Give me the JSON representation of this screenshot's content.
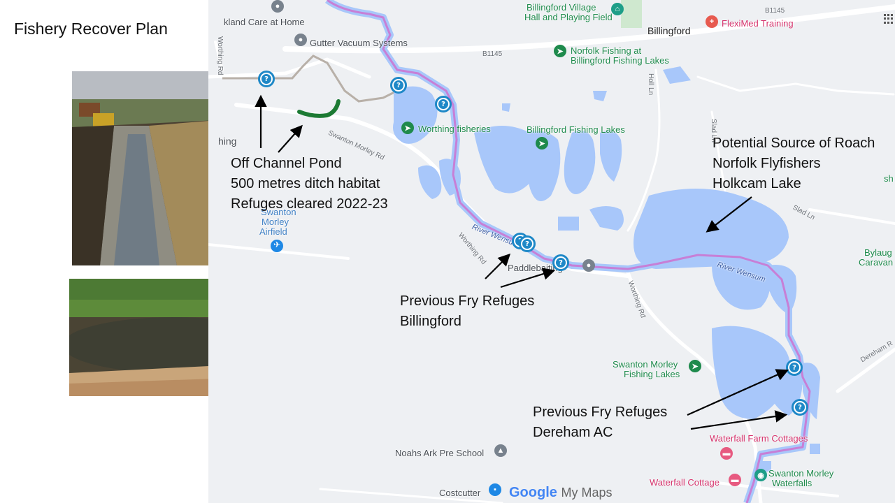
{
  "slide": {
    "title": "Fishery Recover Plan"
  },
  "map": {
    "labels": {
      "care_home": "kland Care at Home",
      "gutter": "Gutter Vacuum Systems",
      "village_hall_1": "Billingford Village",
      "village_hall_2": "Hall and Playing Field",
      "billingford": "Billingford",
      "flexi": "FlexiMed Training",
      "b1145_top": "B1145",
      "b1145_mid": "B1145",
      "norfolk_fishing_1": "Norfolk Fishing at",
      "norfolk_fishing_2": "Billingford Fishing Lakes",
      "worthing_fisheries": "Worthing fisheries",
      "billingford_lakes": "Billingford Fishing Lakes",
      "worthing_rd_1": "Worthing Rd",
      "swanton_morley_rd": "Swanton Morley Rd",
      "hing": "hing",
      "airfield_1": "Swanton",
      "airfield_2": "Morley",
      "airfield_3": "Airfield",
      "river_wensum_1": "River Wensum",
      "worthing_rd_2": "Worthing Rd",
      "paddle": "Paddlebaiting",
      "worthing_rd_3": "Worthing Rd",
      "holl_ln": "Holl Ln",
      "slad_ln_1": "Slad Ln",
      "slad_ln_2": "Slad Ln",
      "river_wensum_2": "River Wensum",
      "bylaug_1": "Bylaug",
      "bylaug_2": "Caravan",
      "sh": "sh",
      "swanton_lakes_1": "Swanton Morley",
      "swanton_lakes_2": "Fishing Lakes",
      "dereham_rd": "Dereham R",
      "waterfall_farm": "Waterfall Farm Cottages",
      "noahs": "Noahs Ark Pre School",
      "costcutter": "Costcutter",
      "waterfall_cottage": "Waterfall Cottage",
      "waterfalls_1": "Swanton Morley",
      "waterfalls_2": "Waterfalls"
    },
    "google_logo": "Google",
    "my_maps": "My Maps"
  },
  "annotations": {
    "off_channel": [
      "Off Channel Pond",
      "500 metres ditch habitat",
      "Refuges cleared 2022-23"
    ],
    "roach": [
      "Potential Source of Roach",
      "Norfolk Flyfishers",
      "Holkcam Lake"
    ],
    "billingford_refuges": [
      "Previous Fry Refuges",
      "Billingford"
    ],
    "dereham_refuges": [
      "Previous Fry Refuges",
      "Dereham AC"
    ]
  },
  "colors": {
    "water": "#a8c7fa",
    "river_route": "#c77fd6",
    "marker": "#1e88c7",
    "ditch": "#1c7a33",
    "map_bg": "#eef0f3"
  }
}
